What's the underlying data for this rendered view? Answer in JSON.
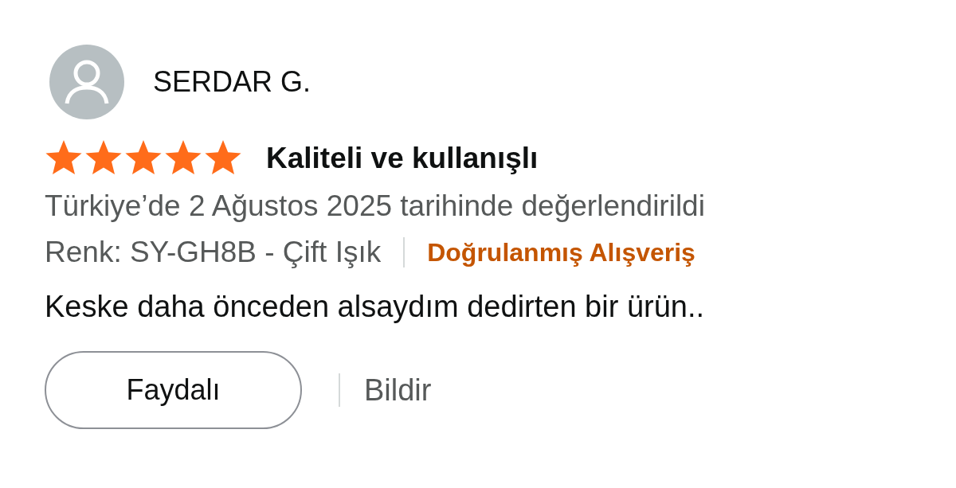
{
  "review": {
    "author": "SERDAR G.",
    "stars": 5,
    "title": "Kaliteli ve kullanışlı",
    "date": "Türkiye’de 2 Ağustos 2025 tarihinde değerlendirildi",
    "variant": "Renk: SY-GH8B - Çift Işık",
    "verified": "Doğrulanmış Alışveriş",
    "body": "Keske daha önceden alsaydım dedirten bir ürün..",
    "helpful_button": "Faydalı",
    "report_link": "Bildir"
  }
}
